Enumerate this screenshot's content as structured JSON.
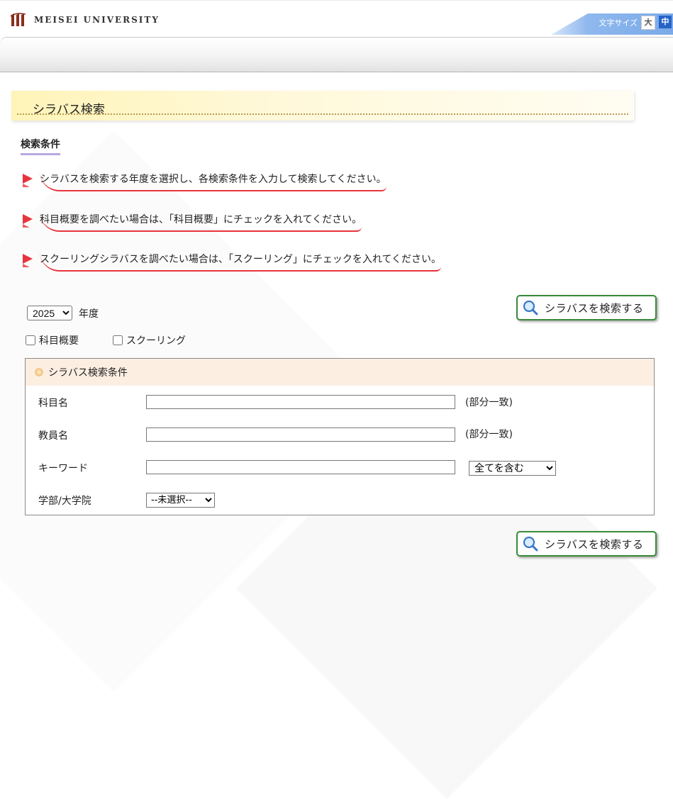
{
  "header": {
    "logo_text": "MEISEI UNIVERSITY",
    "font_size_label": "文字サイズ",
    "font_size_large": "大",
    "font_size_medium": "中"
  },
  "page": {
    "title": "シラバス検索",
    "section_heading": "検索条件",
    "notes": [
      "シラバスを検索する年度を選択し、各検索条件を入力して検索してください。",
      "科目概要を調べたい場合は、「科目概要」にチェックを入れてください。",
      "スクーリングシラバスを調べたい場合は、「スクーリング」にチェックを入れてください。"
    ]
  },
  "year": {
    "value": "2025",
    "label": "年度"
  },
  "search_button_label": "シラバスを検索する",
  "checkboxes": {
    "overview_label": "科目概要",
    "schooling_label": "スクーリング"
  },
  "conditions": {
    "title": "シラバス検索条件",
    "subject_label": "科目名",
    "subject_value": "",
    "subject_note": "(部分一致)",
    "teacher_label": "教員名",
    "teacher_value": "",
    "teacher_note": "(部分一致)",
    "keyword_label": "キーワード",
    "keyword_value": "",
    "keyword_mode": "全てを含む",
    "dept_label": "学部/大学院",
    "dept_value": "--未選択--"
  },
  "colors": {
    "accent_red": "#e8343c",
    "button_border": "#3a8a3a",
    "panel_header": "#fdeee2",
    "banner_yellow": "#fff4b8"
  }
}
